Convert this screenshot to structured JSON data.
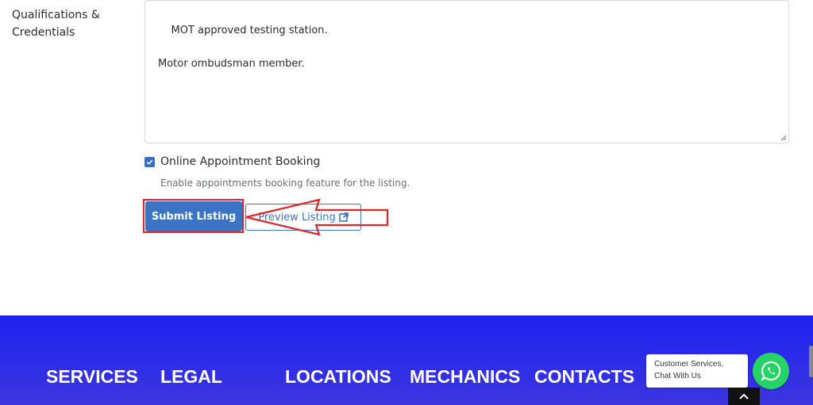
{
  "form": {
    "qualifications_label": "Qualifications & Credentials",
    "qualifications_value": "MOT approved testing station.\n\nMotor ombudsman member.",
    "online_booking": {
      "checked": true,
      "label": "Online Appointment Booking",
      "help": "Enable appointments booking feature for the listing."
    },
    "submit_label": "Submit Listing",
    "preview_label": "Preview Listing"
  },
  "footer": {
    "nav": [
      "SERVICES",
      "LEGAL",
      "LOCATIONS",
      "MECHANICS",
      "CONTACTS"
    ]
  },
  "chat": {
    "bubble_text": "Customer Services, Chat With Us"
  },
  "icons": {
    "external_link": "external-link-icon",
    "checkbox": "checkmark-icon",
    "whatsapp": "whatsapp-icon",
    "scroll_top": "chevron-up-icon"
  },
  "colors": {
    "primary": "#3b74c5",
    "annotation": "#e0242b",
    "footer_bg": "#1f22f0",
    "whatsapp": "#25d366"
  }
}
